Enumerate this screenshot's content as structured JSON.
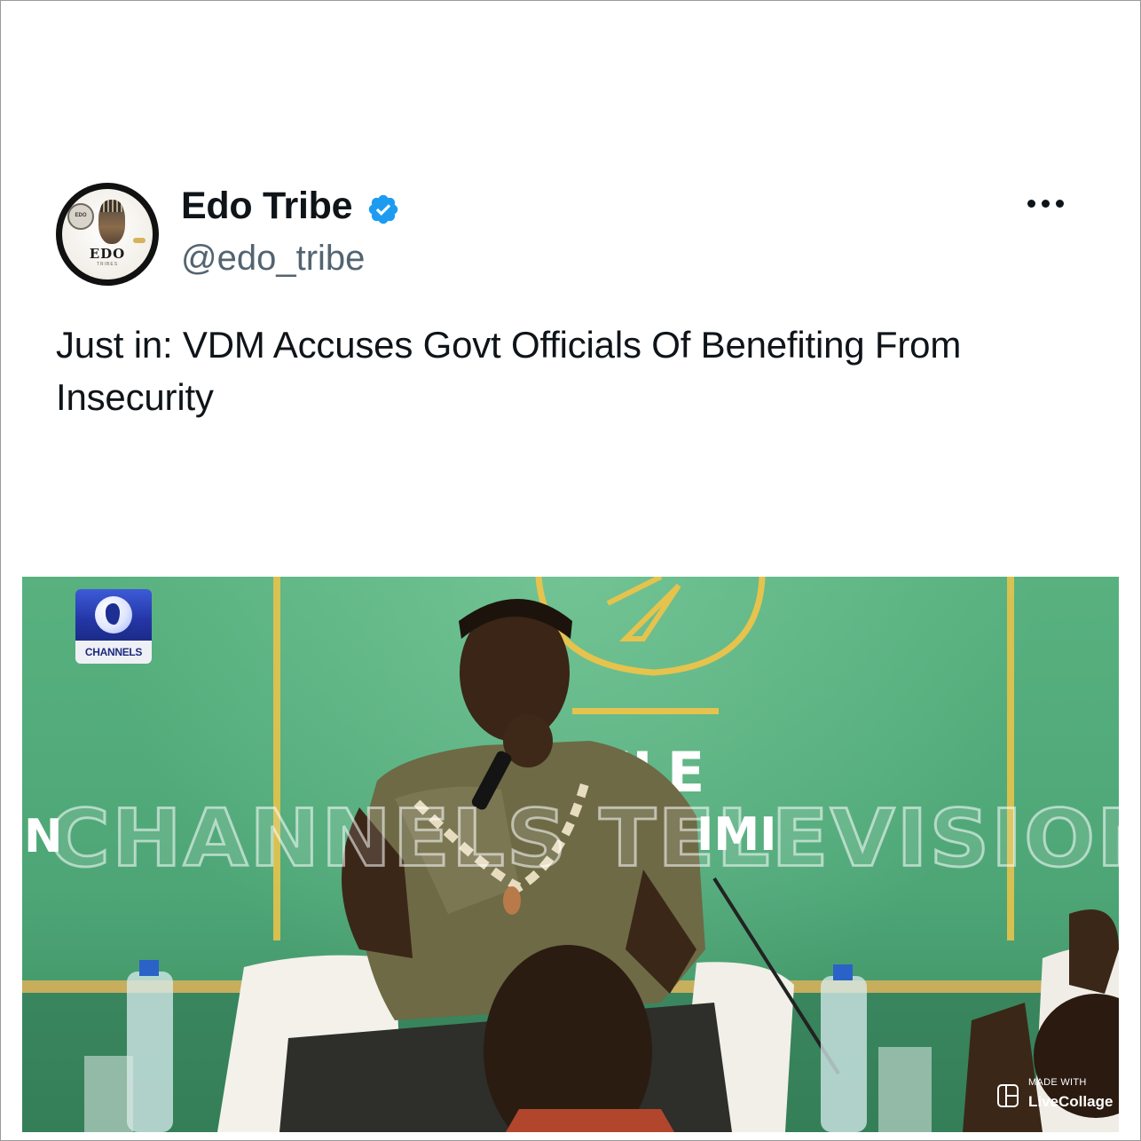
{
  "tweet": {
    "display_name": "Edo Tribe",
    "handle": "@edo_tribe",
    "verified": true,
    "text": "Just in: VDM Accuses Govt Officials Of Benefiting From Insecurity",
    "avatar": {
      "logo_text": "EDO",
      "logo_sub": "TRIBES",
      "seal_text": "EDO"
    },
    "more_icon": "ellipsis-icon"
  },
  "media": {
    "channel_logo_label": "CHANNELS",
    "watermark_text": "CHANNELS TELEVISION",
    "backdrop_left_letter": "N",
    "backdrop_text_1": "ELE",
    "backdrop_text_2": "IMI",
    "made_with_label": "MADE WITH",
    "made_with_app": "LiveCollage"
  },
  "colors": {
    "text_primary": "#0f1419",
    "text_secondary": "#536471",
    "verified_blue": "#1d9bf0",
    "stage_green": "#4ea677",
    "gold_accent": "#e2c24a",
    "channels_blue": "#2436a6"
  }
}
